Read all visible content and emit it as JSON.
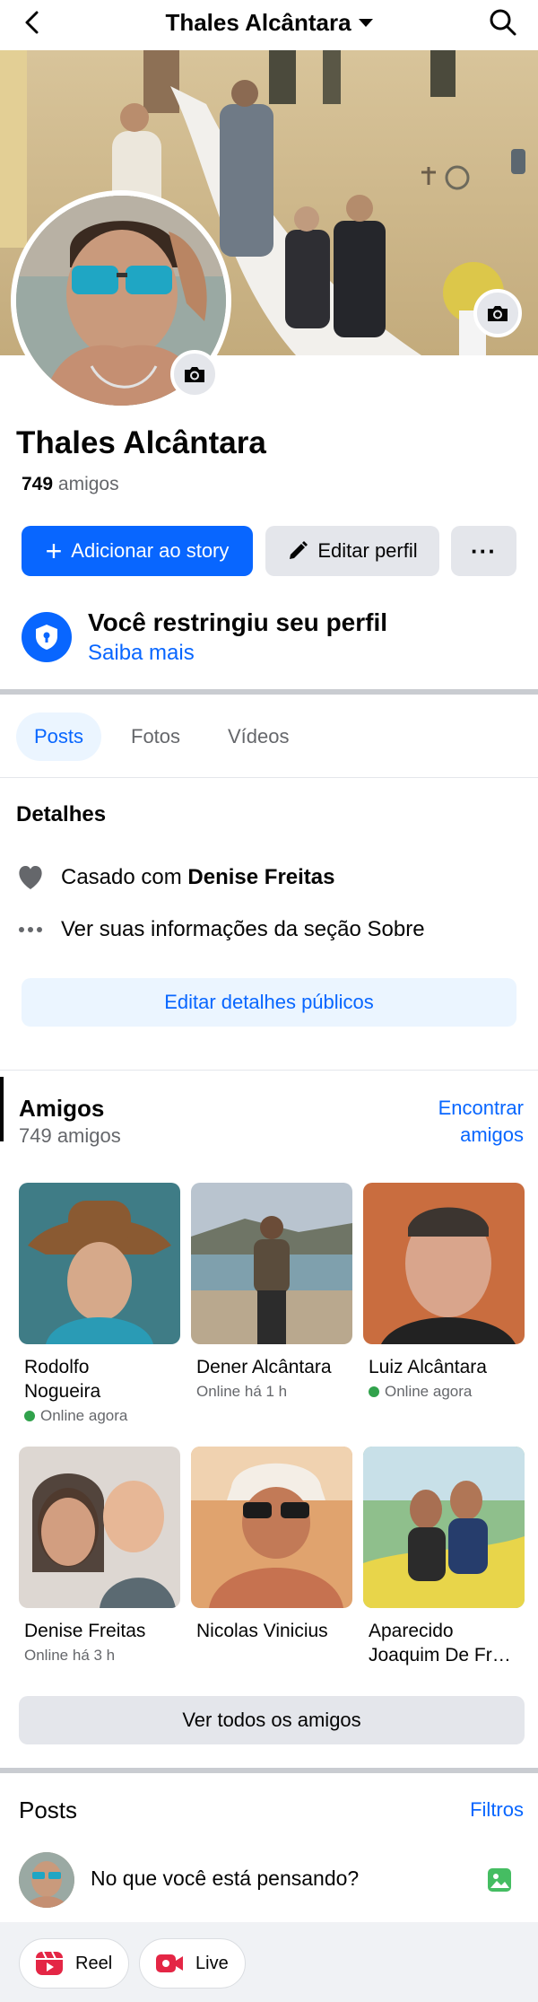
{
  "header": {
    "title": "Thales Alcântara"
  },
  "profile": {
    "name": "Thales Alcântara",
    "friends_count": "749",
    "friends_word": "amigos"
  },
  "actions": {
    "add_story": "Adicionar ao story",
    "edit_profile": "Editar perfil",
    "more": "···"
  },
  "restricted": {
    "title": "Você restringiu seu perfil",
    "link": "Saiba mais"
  },
  "tabs": [
    {
      "label": "Posts",
      "active": true
    },
    {
      "label": "Fotos",
      "active": false
    },
    {
      "label": "Vídeos",
      "active": false
    }
  ],
  "details": {
    "heading": "Detalhes",
    "married_prefix": "Casado com ",
    "married_name": "Denise Freitas",
    "about": "Ver suas informações da seção Sobre",
    "edit_public": "Editar detalhes públicos"
  },
  "friends": {
    "heading": "Amigos",
    "count_label": "749 amigos",
    "find_line1": "Encontrar",
    "find_line2": "amigos",
    "see_all": "Ver todos os amigos",
    "list": [
      {
        "name": "Rodolfo Nogueira",
        "status": "Online agora",
        "online": true
      },
      {
        "name": "Dener Alcântara",
        "status": "Online há 1 h",
        "online": false
      },
      {
        "name": "Luiz Alcântara",
        "status": "Online agora",
        "online": true
      },
      {
        "name": "Denise Freitas",
        "status": "Online há 3 h",
        "online": false
      },
      {
        "name": "Nicolas Vinicius",
        "status": "",
        "online": false
      },
      {
        "name": "Aparecido Joaquim De Fr…",
        "status": "",
        "online": false
      }
    ]
  },
  "posts": {
    "heading": "Posts",
    "filters": "Filtros",
    "composer_placeholder": "No que você está pensando?",
    "reel": "Reel",
    "live": "Live"
  },
  "colors": {
    "accent": "#0866ff",
    "online": "#31a24c",
    "reel_red": "#e42645"
  }
}
